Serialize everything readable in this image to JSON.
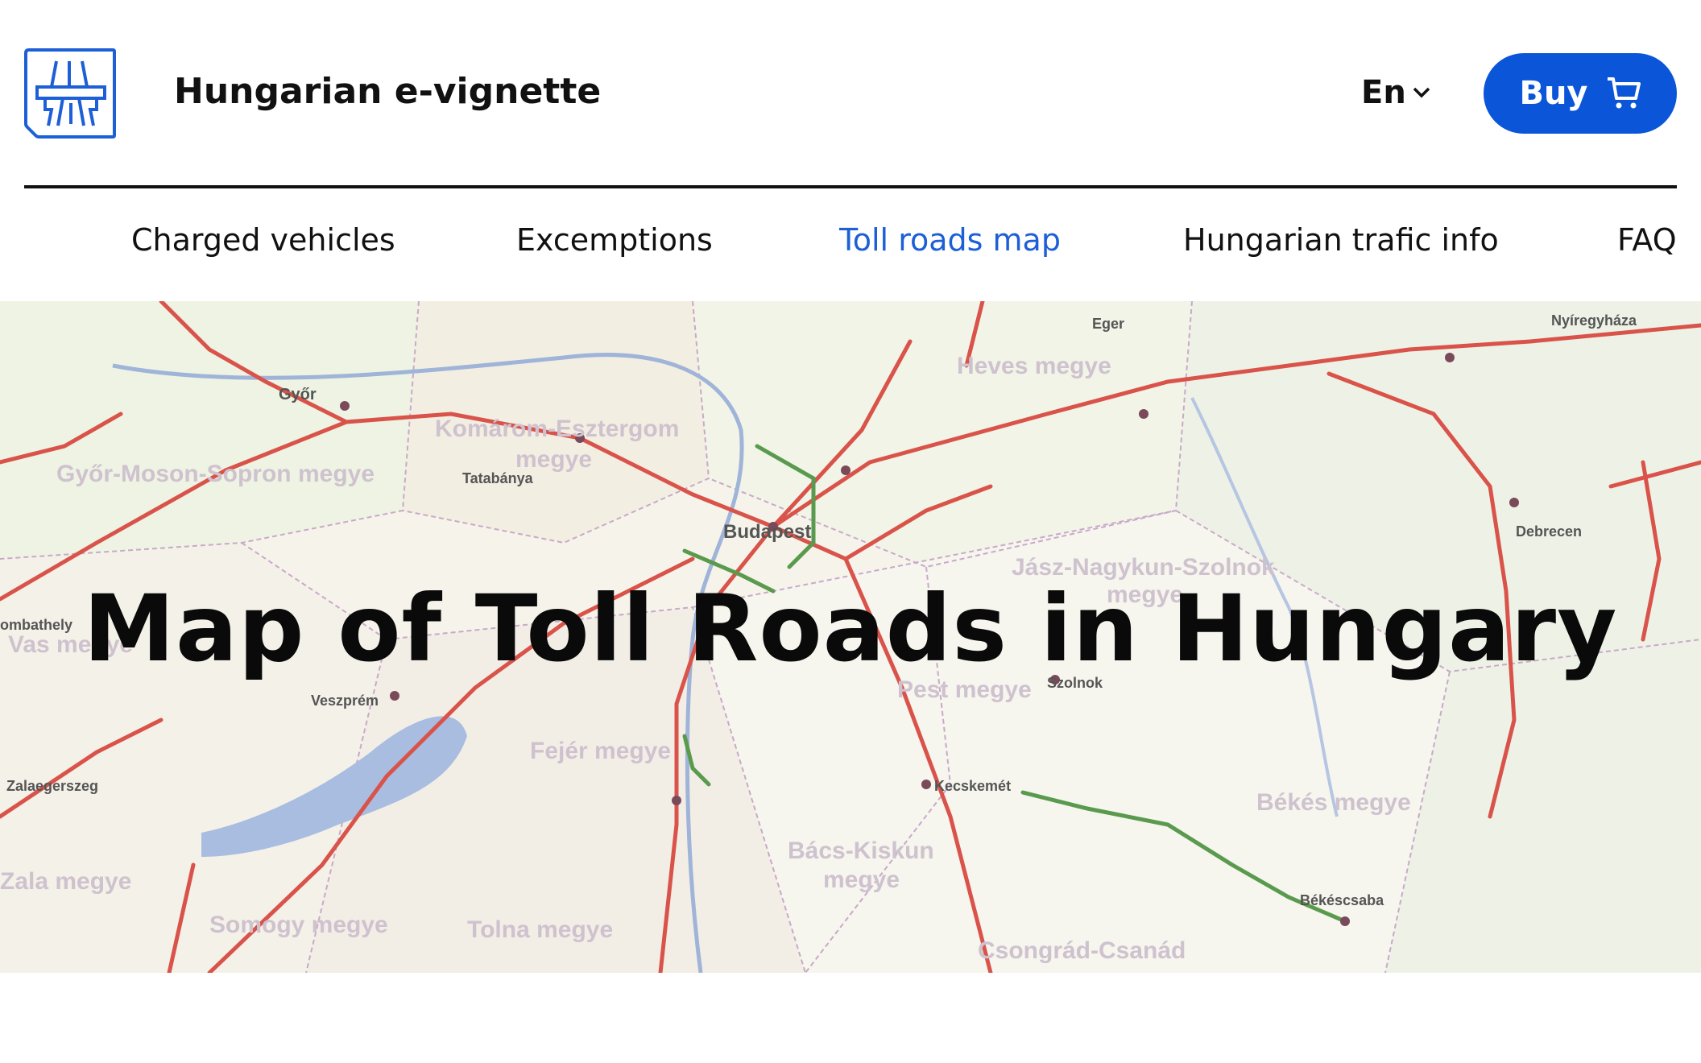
{
  "header": {
    "site_title": "Hungarian e-vignette",
    "language": "En",
    "buy_label": "Buy"
  },
  "nav": {
    "items": [
      {
        "label": "Charged vehicles"
      },
      {
        "label": "Excemptions"
      },
      {
        "label": "Toll roads map",
        "active": true
      },
      {
        "label": "Hungarian trafic info"
      },
      {
        "label": "FAQ"
      }
    ]
  },
  "hero": {
    "title": "Map of Toll Roads in Hungary",
    "map_labels": {
      "gyor": "Győr",
      "tatabanya": "Tatabánya",
      "budapest": "Budapest",
      "eger": "Eger",
      "nyiregyhaza": "Nyíregyháza",
      "debrecen": "Debrecen",
      "szolnok": "Szolnok",
      "kecskemet": "Kecskemét",
      "bekescsaba": "Békéscsaba",
      "veszprem": "Veszprém",
      "zalaegerszeg": "Zalaegerszeg",
      "szombathely": "ombathely",
      "komarom": "Komárom-Esztergom",
      "megye1": "megye",
      "gyms": "Győr-Moson-Sopron megye",
      "heves": "Heves megye",
      "jasz": "Jász-Nagykun-Szolnok",
      "megye2": "megye",
      "vas": "Vas megye",
      "pest": "Pest megye",
      "fejer": "Fejér megye",
      "bacs": "Bács-Kiskun",
      "megye3": "megye",
      "bekes": "Békés megye",
      "zala": "Zala megye",
      "somogy": "Somogy megye",
      "tolna": "Tolna megye",
      "csongrad": "Csongrád-Csanád"
    }
  },
  "colors": {
    "accent": "#0b55d9",
    "active_nav": "#1d5fd6",
    "toll_road": "#d9534a",
    "free_road": "#5a9a4e",
    "lake": "#a9bde0"
  }
}
